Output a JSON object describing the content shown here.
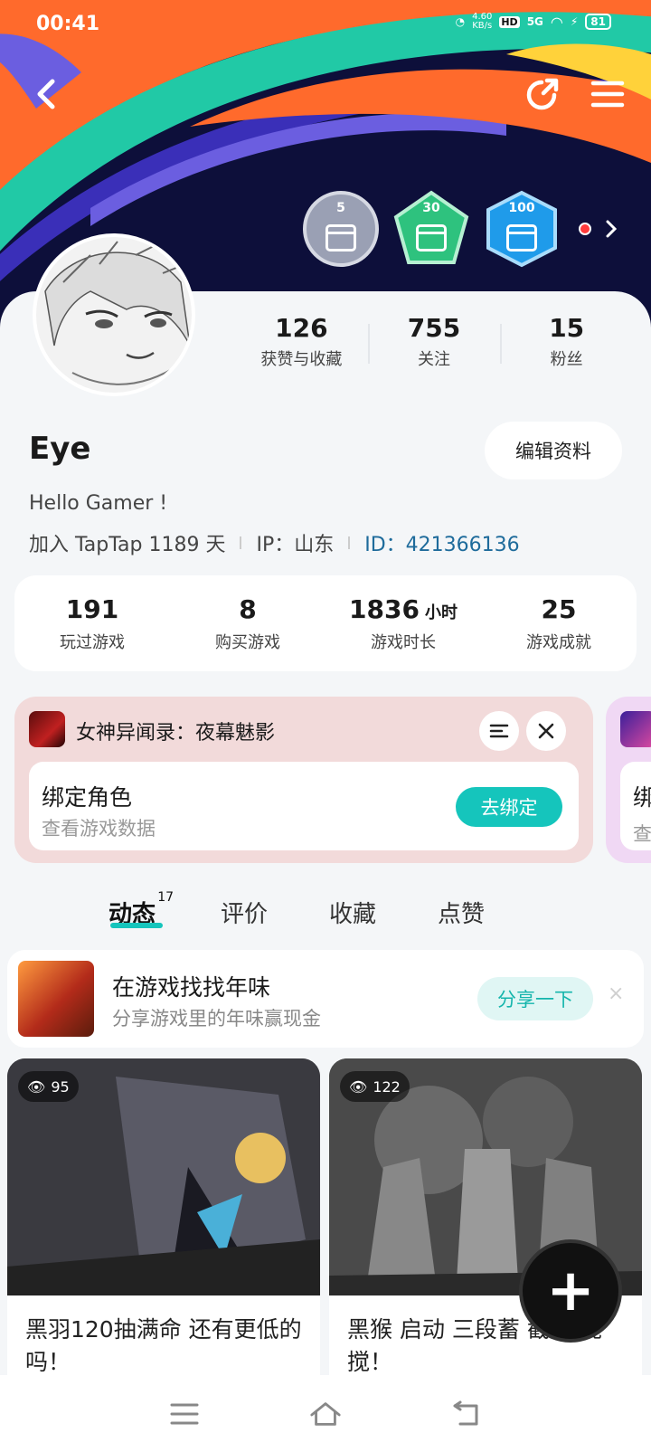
{
  "status_bar": {
    "time": "00:41",
    "speed": "4.60",
    "speed_unit": "KB/s",
    "hd": "HD",
    "network": "5G",
    "battery": "81"
  },
  "header": {
    "back_icon": "back-arrow-icon",
    "share_icon": "share-icon",
    "menu_icon": "menu-icon"
  },
  "badges": [
    {
      "value": "5",
      "color": "#9aa0b4"
    },
    {
      "value": "30",
      "color": "#2ec27e"
    },
    {
      "value": "100",
      "color": "#1f9bea"
    }
  ],
  "profile": {
    "stats": [
      {
        "value": "126",
        "label": "获赞与收藏"
      },
      {
        "value": "755",
        "label": "关注"
      },
      {
        "value": "15",
        "label": "粉丝"
      }
    ],
    "name": "Eye",
    "edit_label": "编辑资料",
    "bio": "Hello Gamer !",
    "joined": "加入 TapTap 1189 天",
    "ip": "IP：山东",
    "id_label": "ID：",
    "id_value": "421366136"
  },
  "game_stats": [
    {
      "value": "191",
      "unit": "",
      "label": "玩过游戏"
    },
    {
      "value": "8",
      "unit": "",
      "label": "购买游戏"
    },
    {
      "value": "1836",
      "unit": "小时",
      "label": "游戏时长"
    },
    {
      "value": "25",
      "unit": "",
      "label": "游戏成就"
    }
  ],
  "bind_card": {
    "game_title": "女神异闻录：夜幕魅影",
    "title": "绑定角色",
    "subtitle": "查看游戏数据",
    "button": "去绑定",
    "next_partial": "绑",
    "next_partial_sub": "查"
  },
  "tabs": [
    {
      "label": "动态",
      "count": "17",
      "active": true
    },
    {
      "label": "评价"
    },
    {
      "label": "收藏"
    },
    {
      "label": "点赞"
    }
  ],
  "promo": {
    "title": "在游戏找找年味",
    "subtitle": "分享游戏里的年味赢现金",
    "button": "分享一下",
    "close": "×"
  },
  "posts": [
    {
      "views": "95",
      "caption": "黑羽120抽满命 还有更低的吗！"
    },
    {
      "views": "122",
      "caption": "黑猴 启动 三段蓄 截 搅搅搅！"
    }
  ],
  "fab": {
    "label": "+"
  },
  "colors": {
    "accent": "#15c5bc",
    "id_link": "#1e6b9b",
    "banner_bg": "#0d0f3a"
  }
}
